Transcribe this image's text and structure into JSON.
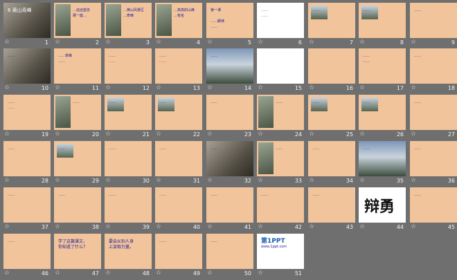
{
  "slides": [
    {
      "n": "1",
      "style": "rock",
      "lines": [
        "6 黄山奇峰"
      ],
      "accent": "#e0e0ff"
    },
    {
      "n": "2",
      "style": "base",
      "lines": [
        "…远远望去",
        "那一座…"
      ]
    },
    {
      "n": "3",
      "style": "base",
      "lines": [
        "…黄山风景区",
        "…奇峰"
      ]
    },
    {
      "n": "4",
      "style": "base",
      "lines": [
        "…高高的山峰",
        "…有名"
      ]
    },
    {
      "n": "5",
      "style": "base",
      "lines": [
        "第一课",
        "",
        "……朗读",
        "……"
      ]
    },
    {
      "n": "6",
      "style": "white",
      "lines": [
        "……",
        "……"
      ]
    },
    {
      "n": "7",
      "style": "base",
      "lines": [
        "……",
        "……"
      ]
    },
    {
      "n": "8",
      "style": "base",
      "lines": [
        "……"
      ]
    },
    {
      "n": "9",
      "style": "base",
      "lines": [
        "……"
      ]
    },
    {
      "n": "10",
      "style": "rock",
      "lines": [
        "……"
      ]
    },
    {
      "n": "11",
      "style": "base",
      "lines": [
        "……奇峰",
        "……"
      ]
    },
    {
      "n": "12",
      "style": "base",
      "lines": [
        "……",
        "……"
      ]
    },
    {
      "n": "13",
      "style": "base",
      "lines": [
        "……",
        "……"
      ]
    },
    {
      "n": "14",
      "style": "mist",
      "lines": [
        "……"
      ]
    },
    {
      "n": "15",
      "style": "white",
      "lines": [
        ""
      ]
    },
    {
      "n": "16",
      "style": "base",
      "lines": [
        ""
      ]
    },
    {
      "n": "17",
      "style": "base",
      "lines": [
        "……",
        "……"
      ]
    },
    {
      "n": "18",
      "style": "base",
      "lines": [
        "……"
      ]
    },
    {
      "n": "19",
      "style": "base",
      "lines": [
        "……",
        "……"
      ]
    },
    {
      "n": "20",
      "style": "base",
      "lines": [
        "……"
      ]
    },
    {
      "n": "21",
      "style": "base",
      "lines": [
        "……"
      ]
    },
    {
      "n": "22",
      "style": "base",
      "lines": [
        "……"
      ]
    },
    {
      "n": "23",
      "style": "base",
      "lines": [
        "……"
      ]
    },
    {
      "n": "24",
      "style": "base",
      "lines": [
        "……"
      ]
    },
    {
      "n": "25",
      "style": "base",
      "lines": [
        "……",
        "……"
      ]
    },
    {
      "n": "26",
      "style": "base",
      "lines": [
        "……"
      ]
    },
    {
      "n": "27",
      "style": "base",
      "lines": [
        "……"
      ]
    },
    {
      "n": "28",
      "style": "base",
      "lines": [
        "……"
      ]
    },
    {
      "n": "29",
      "style": "base",
      "lines": [
        "……"
      ]
    },
    {
      "n": "30",
      "style": "base",
      "lines": [
        "……"
      ]
    },
    {
      "n": "31",
      "style": "base",
      "lines": [
        "……"
      ]
    },
    {
      "n": "32",
      "style": "rock",
      "lines": [
        "……"
      ]
    },
    {
      "n": "33",
      "style": "base",
      "lines": [
        "……"
      ]
    },
    {
      "n": "34",
      "style": "base",
      "lines": [
        "……"
      ]
    },
    {
      "n": "35",
      "style": "mist",
      "lines": [
        "……"
      ]
    },
    {
      "n": "36",
      "style": "base",
      "lines": [
        "……"
      ]
    },
    {
      "n": "37",
      "style": "base",
      "lines": [
        "……"
      ]
    },
    {
      "n": "38",
      "style": "base",
      "lines": [
        "……"
      ]
    },
    {
      "n": "39",
      "style": "base",
      "lines": [
        "……"
      ]
    },
    {
      "n": "40",
      "style": "base",
      "lines": [
        "……"
      ]
    },
    {
      "n": "41",
      "style": "base",
      "lines": [
        "……"
      ]
    },
    {
      "n": "42",
      "style": "base",
      "lines": [
        "……"
      ]
    },
    {
      "n": "43",
      "style": "base",
      "lines": [
        "……"
      ]
    },
    {
      "n": "44",
      "style": "white",
      "lines": [
        "辩勇"
      ]
    },
    {
      "n": "45",
      "style": "base",
      "lines": [
        "……"
      ]
    },
    {
      "n": "46",
      "style": "base",
      "lines": [
        "……"
      ]
    },
    {
      "n": "47",
      "style": "base",
      "lines": [
        "学了这篇课文，",
        "你知道了什么？"
      ]
    },
    {
      "n": "48",
      "style": "base",
      "lines": [
        "要会从别人身",
        "上汲取力量。"
      ]
    },
    {
      "n": "49",
      "style": "base",
      "lines": [
        "……"
      ]
    },
    {
      "n": "50",
      "style": "base",
      "lines": [
        "……"
      ]
    },
    {
      "n": "51",
      "style": "white",
      "lines": [
        "第1PPT",
        "www.1ppt.com"
      ]
    }
  ],
  "star_glyph": "☆"
}
